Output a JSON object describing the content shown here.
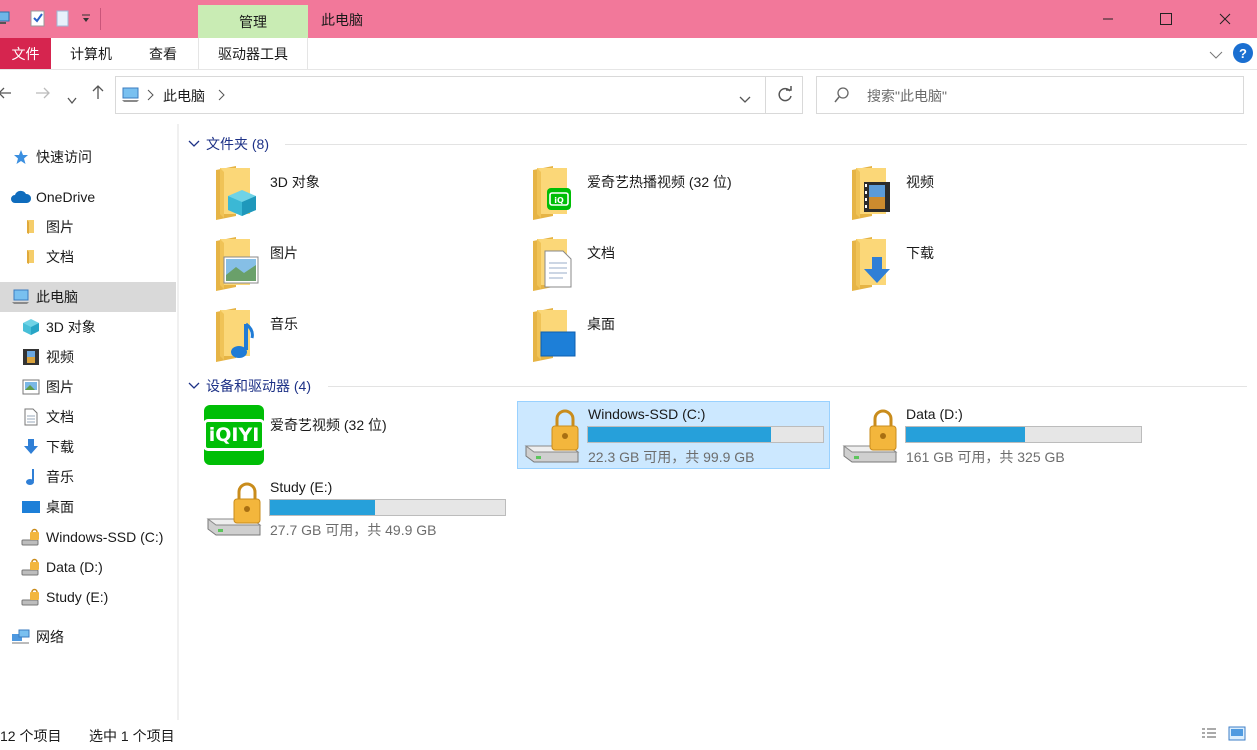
{
  "window": {
    "title": "此电脑",
    "contextual_tab": "管理"
  },
  "ribbon": {
    "tabs": [
      "文件",
      "计算机",
      "查看",
      "驱动器工具"
    ],
    "help": "?"
  },
  "nav": {
    "address_path": "此电脑",
    "search_placeholder": "搜索\"此电脑\""
  },
  "sidebar": {
    "items": [
      {
        "label": "快速访问",
        "icon": "star-icon"
      },
      {
        "label": "OneDrive",
        "icon": "cloud-icon"
      },
      {
        "label": "图片",
        "icon": "folder-icon"
      },
      {
        "label": "文档",
        "icon": "folder-icon"
      },
      {
        "label": "此电脑",
        "icon": "computer-icon",
        "selected": true
      },
      {
        "label": "3D 对象",
        "icon": "cube-icon"
      },
      {
        "label": "视频",
        "icon": "film-icon"
      },
      {
        "label": "图片",
        "icon": "picture-icon"
      },
      {
        "label": "文档",
        "icon": "document-icon"
      },
      {
        "label": "下载",
        "icon": "download-icon"
      },
      {
        "label": "音乐",
        "icon": "music-icon"
      },
      {
        "label": "桌面",
        "icon": "desktop-icon"
      },
      {
        "label": "Windows-SSD (C:)",
        "icon": "drive-icon"
      },
      {
        "label": "Data (D:)",
        "icon": "drive-icon"
      },
      {
        "label": "Study (E:)",
        "icon": "drive-icon"
      },
      {
        "label": "网络",
        "icon": "network-icon"
      }
    ]
  },
  "folders": {
    "header": "文件夹 (8)",
    "items": [
      {
        "label": "3D 对象",
        "icon": "cube-folder-icon"
      },
      {
        "label": "爱奇艺热播视频 (32 位)",
        "icon": "iqiyi-folder-icon"
      },
      {
        "label": "视频",
        "icon": "video-folder-icon"
      },
      {
        "label": "图片",
        "icon": "pictures-folder-icon"
      },
      {
        "label": "文档",
        "icon": "documents-folder-icon"
      },
      {
        "label": "下载",
        "icon": "downloads-folder-icon"
      },
      {
        "label": "音乐",
        "icon": "music-folder-icon"
      },
      {
        "label": "桌面",
        "icon": "desktop-folder-icon"
      }
    ]
  },
  "devices": {
    "header": "设备和驱动器 (4)",
    "app_shortcut": {
      "label": "爱奇艺视频 (32 位)",
      "logo_text": "iQIYI"
    },
    "drives": [
      {
        "label": "Windows-SSD (C:)",
        "sub": "22.3 GB 可用，共 99.9 GB",
        "used_fraction": 0.777,
        "selected": true
      },
      {
        "label": "Data (D:)",
        "sub": "161 GB 可用，共 325 GB",
        "used_fraction": 0.505
      },
      {
        "label": "Study (E:)",
        "sub": "27.7 GB 可用，共 49.9 GB",
        "used_fraction": 0.445
      }
    ]
  },
  "status": {
    "item_count": "12 个项目",
    "selected": "选中 1 个项目"
  },
  "colors": {
    "titlebar": "#f2789a",
    "manage_tab": "#c9ecb4",
    "file_tab": "#d6254f",
    "selection": "#cce8ff",
    "bar_fill": "#26a0da",
    "group_header": "#1e3287"
  }
}
